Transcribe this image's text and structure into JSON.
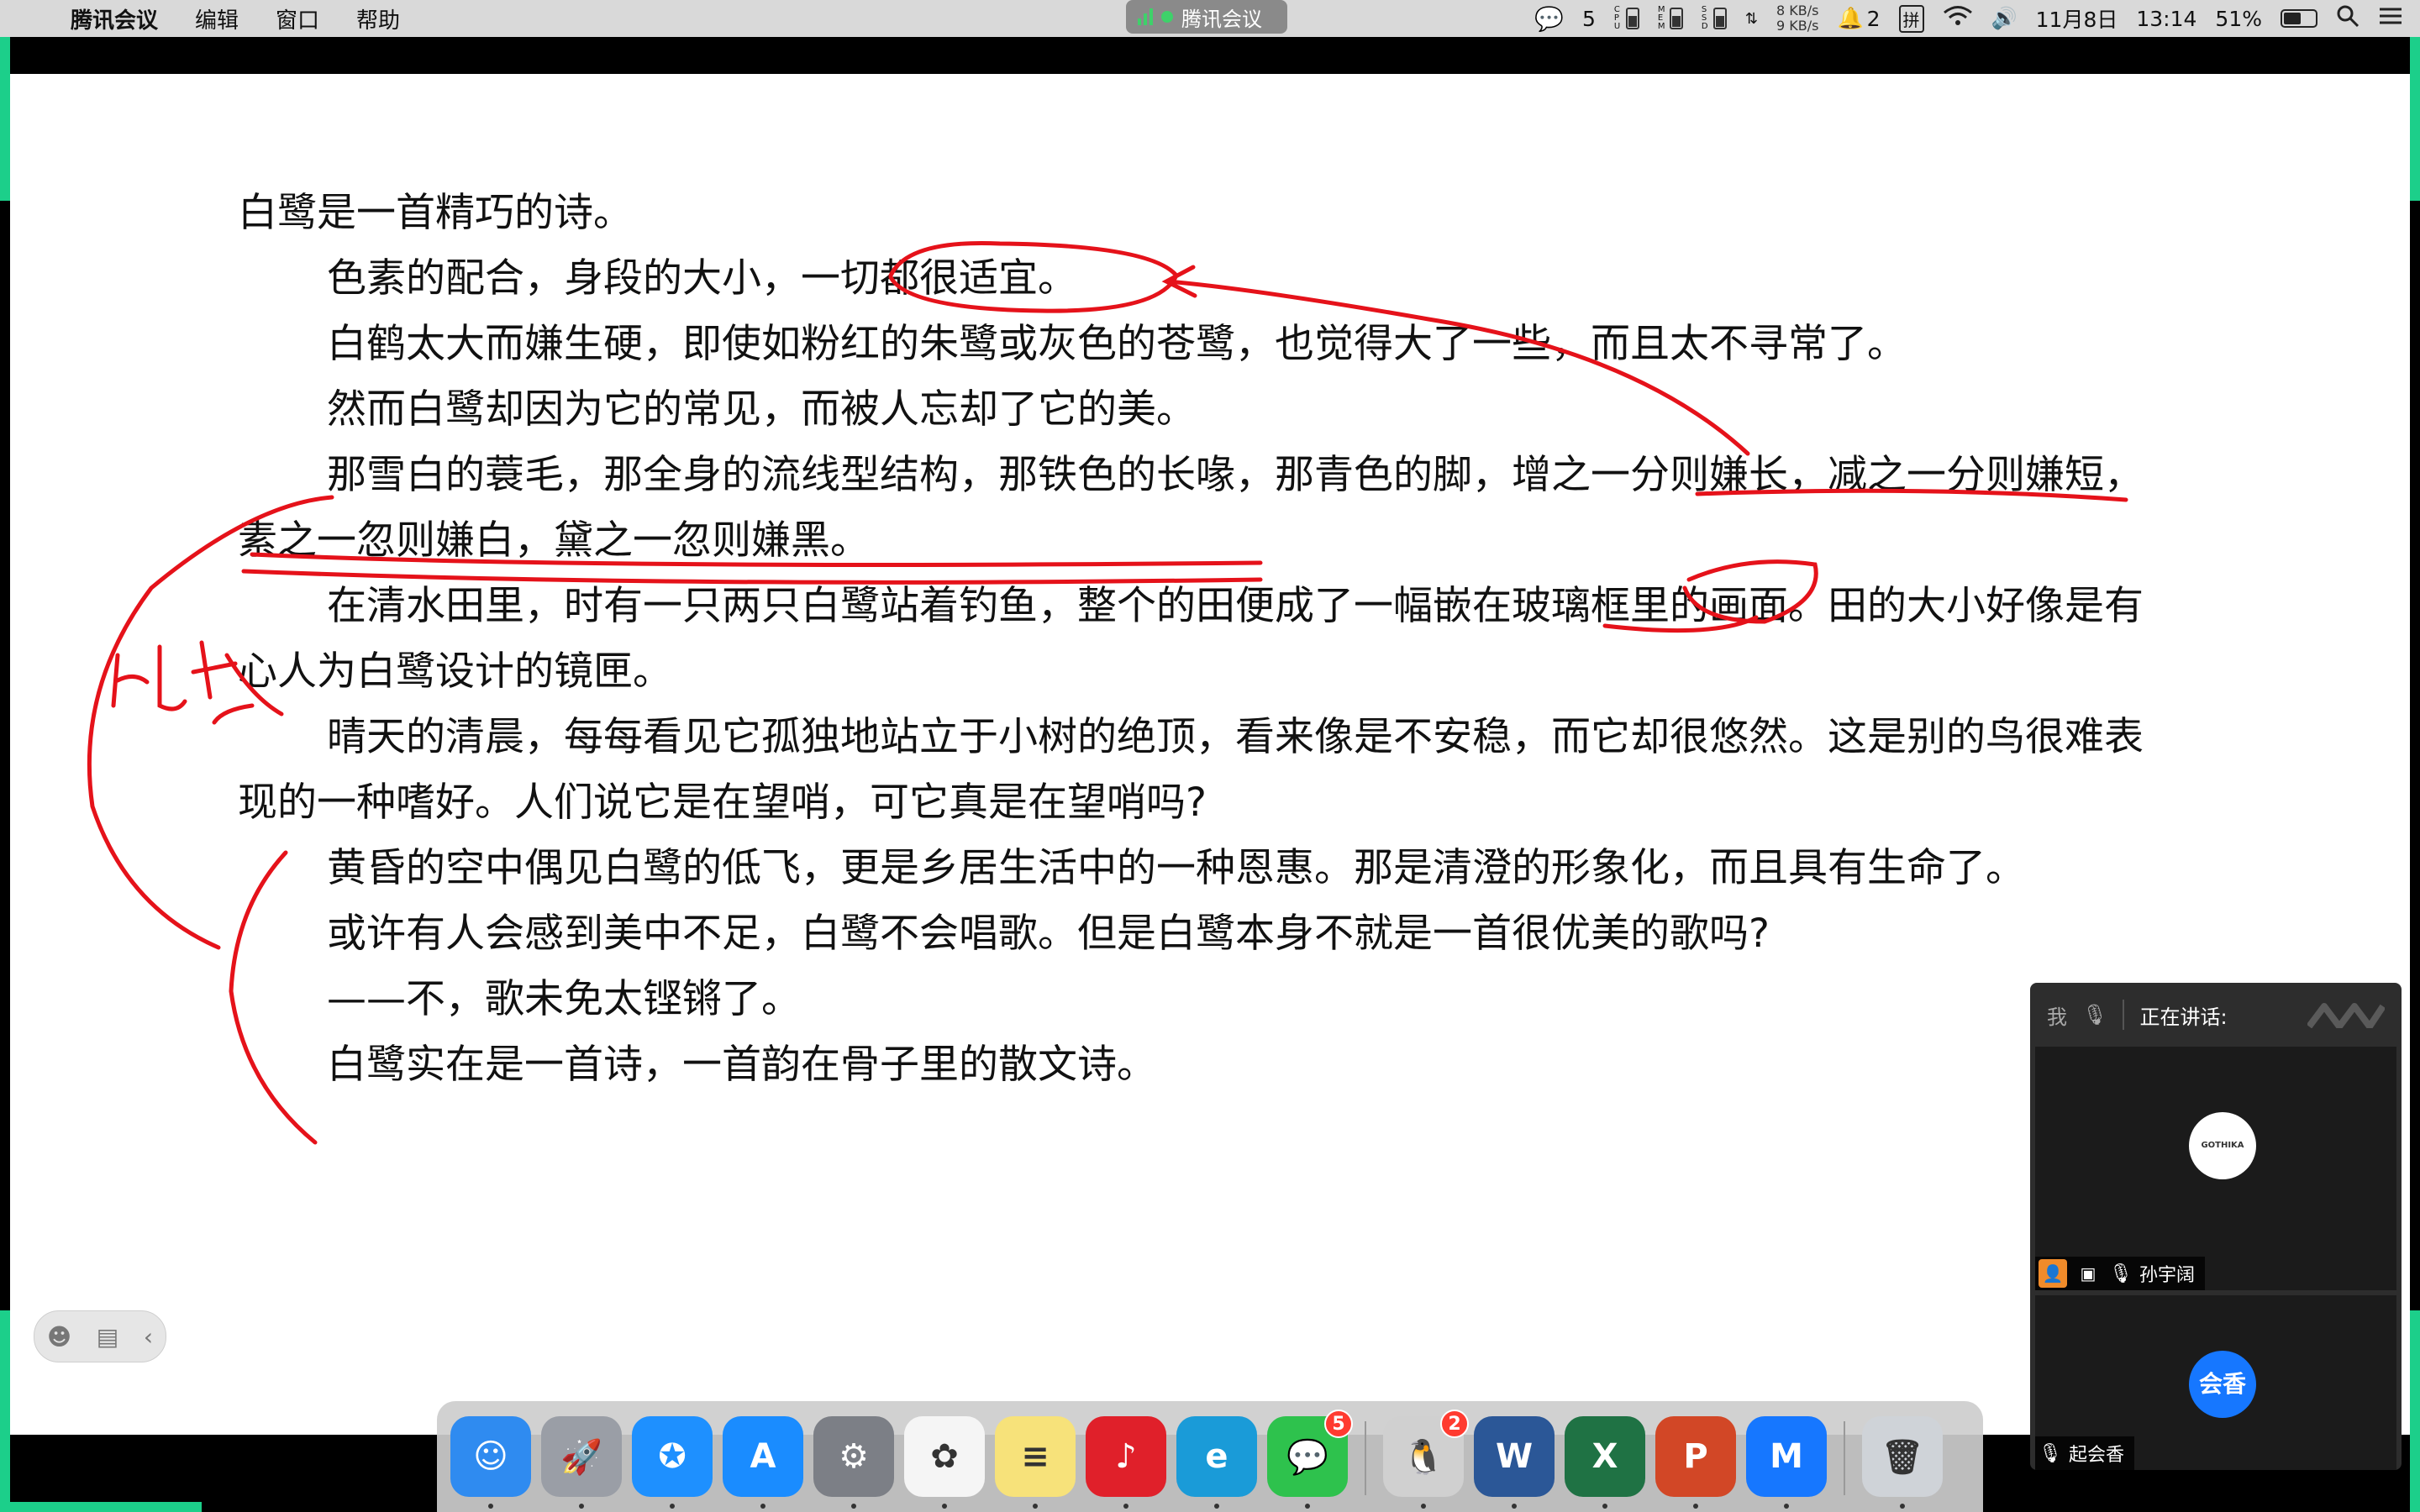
{
  "menubar": {
    "app_name": "腾讯会议",
    "menus": [
      "编辑",
      "窗口",
      "帮助"
    ],
    "center_label": "腾讯会议",
    "wechat_count": "5",
    "cpu_label": "CPU",
    "mem_label": "MEM",
    "ssd_label": "SSD",
    "net_up": "8 KB/s",
    "net_down": "9 KB/s",
    "notif_count": "2",
    "input_method": "拼",
    "date": "11月8日",
    "time": "13:14",
    "battery": "51%"
  },
  "document": {
    "paragraphs": [
      "白鹭是一首精巧的诗。",
      "色素的配合，身段的大小，一切都很适宜。",
      "白鹤太大而嫌生硬，即使如粉红的朱鹭或灰色的苍鹭，也觉得大了一些，而且太不寻常了。",
      "然而白鹭却因为它的常见，而被人忘却了它的美。",
      "那雪白的蓑毛，那全身的流线型结构，那铁色的长喙，那青色的脚，增之一分则嫌长，减之一分则嫌短，素之一忽则嫌白，黛之一忽则嫌黑。",
      "在清水田里，时有一只两只白鹭站着钓鱼，整个的田便成了一幅嵌在玻璃框里的画面。田的大小好像是有心人为白鹭设计的镜匣。",
      "晴天的清晨，每每看见它孤独地站立于小树的绝顶，看来像是不安稳，而它却很悠然。这是别的鸟很难表现的一种嗜好。人们说它是在望哨，可它真是在望哨吗?",
      "黄昏的空中偶见白鹭的低飞，更是乡居生活中的一种恩惠。那是清澄的形象化，而且具有生命了。",
      "或许有人会感到美中不足，白鹭不会唱歌。但是白鹭本身不就是一首很优美的歌吗?",
      "——不，歌未免太铿锵了。",
      "白鹭实在是一首诗，一首韵在骨子里的散文诗。"
    ],
    "handwritten_note": "比较"
  },
  "panel": {
    "me_label": "我",
    "speaking_label": "正在讲话:",
    "participants": [
      {
        "name": "孙宇阔",
        "avatar_text": "GOTHIKA"
      },
      {
        "name": "起会香",
        "avatar_text": "会香"
      }
    ]
  },
  "dock": {
    "apps": [
      {
        "name": "Finder",
        "icon": "finder-icon",
        "color": "#2f8bf0",
        "glyph": "☺"
      },
      {
        "name": "Launchpad",
        "icon": "rocket-icon",
        "color": "#9a9ea6",
        "glyph": "🚀"
      },
      {
        "name": "Safari",
        "icon": "compass-icon",
        "color": "#1e90ff",
        "glyph": "✪"
      },
      {
        "name": "App Store",
        "icon": "appstore-icon",
        "color": "#1a8cff",
        "glyph": "A"
      },
      {
        "name": "System Preferences",
        "icon": "gear-icon",
        "color": "#7c7f86",
        "glyph": "⚙"
      },
      {
        "name": "Photos",
        "icon": "photos-icon",
        "color": "#f5f5f5",
        "glyph": "✿"
      },
      {
        "name": "Notes",
        "icon": "notes-icon",
        "color": "#f7e27a",
        "glyph": "≡"
      },
      {
        "name": "NetEase Music",
        "icon": "music-icon",
        "color": "#e0202a",
        "glyph": "♪"
      },
      {
        "name": "Edge",
        "icon": "edge-icon",
        "color": "#1a9bd8",
        "glyph": "e"
      },
      {
        "name": "WeChat",
        "icon": "wechat-icon",
        "color": "#2ec24d",
        "glyph": "💬",
        "badge": "5"
      },
      {
        "name": "QQ",
        "icon": "penguin-icon",
        "color": "#d0d0d0",
        "glyph": "🐧",
        "badge": "2"
      },
      {
        "name": "Word",
        "icon": "word-icon",
        "color": "#2b5797",
        "glyph": "W"
      },
      {
        "name": "Excel",
        "icon": "excel-icon",
        "color": "#1f7244",
        "glyph": "X"
      },
      {
        "name": "PowerPoint",
        "icon": "powerpoint-icon",
        "color": "#d24726",
        "glyph": "P"
      },
      {
        "name": "Tencent Meeting",
        "icon": "meeting-icon",
        "color": "#1677ff",
        "glyph": "M"
      },
      {
        "name": "Trash",
        "icon": "trash-icon",
        "color": "#cfd3d8",
        "glyph": "🗑"
      }
    ]
  },
  "colors": {
    "annotation_red": "#e5121a",
    "share_border": "#1ccf8a",
    "avatar_blue": "#1677ff"
  }
}
